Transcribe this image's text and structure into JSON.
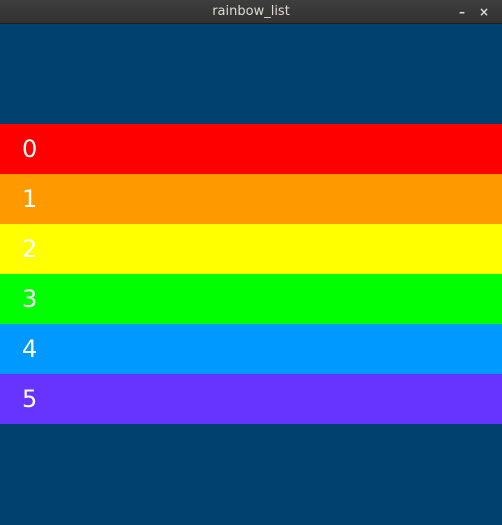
{
  "window": {
    "title": "rainbow_list",
    "minimize_glyph": "–",
    "close_glyph": "×"
  },
  "colors": {
    "background": "#01416f"
  },
  "list": {
    "items": [
      {
        "label": "0",
        "color": "#ff0000"
      },
      {
        "label": "1",
        "color": "#ff9900"
      },
      {
        "label": "2",
        "color": "#ffff00"
      },
      {
        "label": "3",
        "color": "#00ff00"
      },
      {
        "label": "4",
        "color": "#0099ff"
      },
      {
        "label": "5",
        "color": "#6633ff"
      }
    ]
  }
}
